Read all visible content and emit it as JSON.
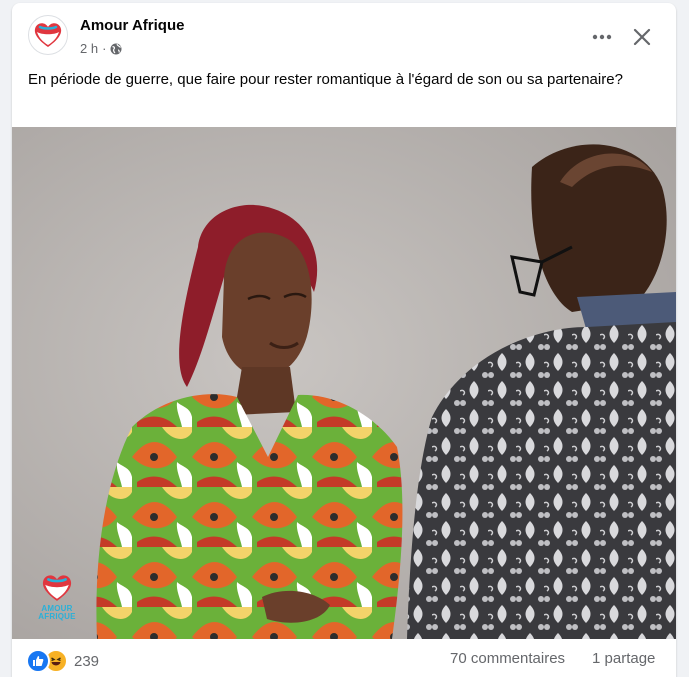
{
  "post": {
    "page_name": "Amour Afrique",
    "time": "2 h",
    "audience_icon": "globe-icon",
    "text": "En période de guerre, que faire pour rester romantique à l'égard de son ou sa partenaire?",
    "photo_watermark": "AMOUR AFRIQUE"
  },
  "header": {
    "more_icon": "more-options-icon",
    "close_icon": "close-icon"
  },
  "footer": {
    "reactions": [
      "like-icon",
      "haha-icon"
    ],
    "reaction_count": "239",
    "comments": "70 commentaires",
    "shares": "1 partage"
  },
  "colors": {
    "brand_red": "#e0363f",
    "brand_blue": "#2ab0d8",
    "like_blue": "#1877f2",
    "haha_yellow": "#f7b125"
  }
}
